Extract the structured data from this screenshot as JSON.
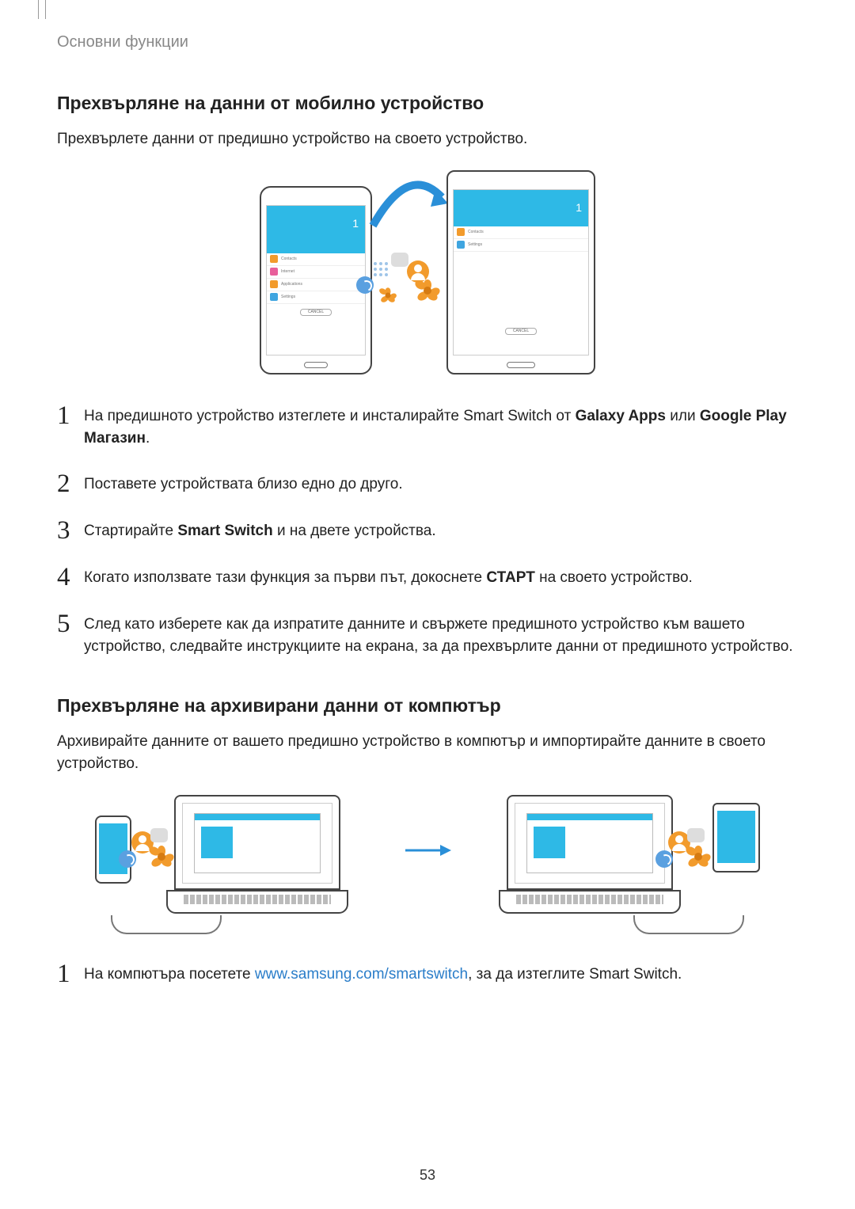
{
  "header": {
    "breadcrumb": "Основни функции"
  },
  "section1": {
    "title": "Прехвърляне на данни от мобилно устройство",
    "intro": "Прехвърлете данни от предишно устройство на своето устройство.",
    "steps": [
      {
        "n": "1",
        "pre": "На предишното устройство изтеглете и инсталирайте Smart Switch от ",
        "b1": "Galaxy Apps",
        "mid": " или ",
        "b2": "Google Play Магазин",
        "post": "."
      },
      {
        "n": "2",
        "text": "Поставете устройствата близо едно до друго."
      },
      {
        "n": "3",
        "pre": "Стартирайте ",
        "b1": "Smart Switch",
        "post": " и на двете устройства."
      },
      {
        "n": "4",
        "pre": "Когато използвате тази функция за първи път, докоснете ",
        "b1": "СТАРТ",
        "post": " на своето устройство."
      },
      {
        "n": "5",
        "text": "След като изберете как да изпратите данните и свържете предишното устройство към вашето устройство, следвайте инструкциите на екрана, за да прехвърлите данни от предишното устройство."
      }
    ]
  },
  "section2": {
    "title": "Прехвърляне на архивирани данни от компютър",
    "intro": "Архивирайте данните от вашето предишно устройство в компютър и импортирайте данните в своето устройство.",
    "steps": [
      {
        "n": "1",
        "pre": "На компютъра посетете ",
        "link_text": "www.samsung.com/smartswitch",
        "link_href": "http://www.samsung.com/smartswitch",
        "post": ", за да изтеглите Smart Switch."
      }
    ]
  },
  "illus1": {
    "phone_items": [
      "Contacts",
      "Internet",
      "Applications",
      "Settings"
    ],
    "tablet_items": [
      "Contacts",
      "Settings"
    ],
    "percent": "1",
    "cancel": "CANCEL"
  },
  "pageNumber": "53"
}
